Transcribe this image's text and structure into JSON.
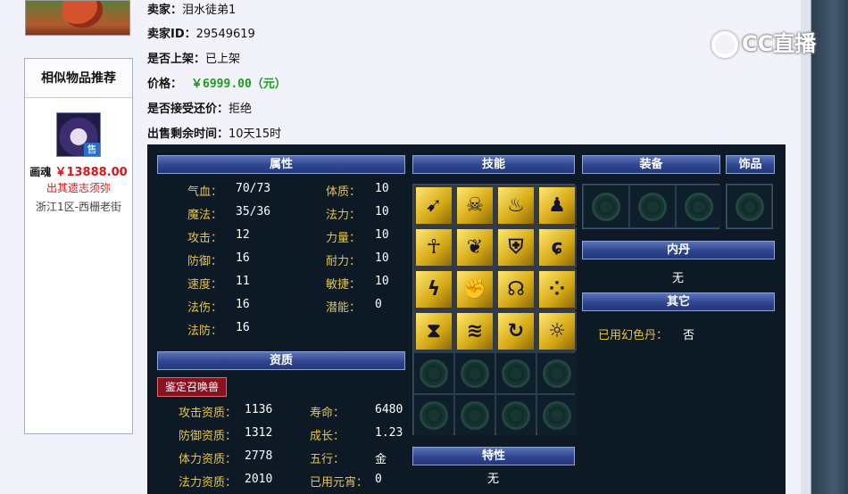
{
  "seller": {
    "name_label": "卖家：",
    "name": "泪水徒弟1",
    "id_label": "卖家ID：",
    "id": "29549619",
    "listed_label": "是否上架：",
    "listed": "已上架",
    "price_label": "价格：",
    "price": "￥6999.00（元）",
    "counter_label": "是否接受还价：",
    "counter": "拒绝",
    "time_label": "出售剩余时间：",
    "time": "10天15时"
  },
  "recommend": {
    "title": "相似物品推荐",
    "item_name": "画魂",
    "item_price": "￥13888.00",
    "item_note": "出其遗志须弥",
    "item_server": "浙江1区-西栅老街",
    "sold_badge": "售"
  },
  "watermark": {
    "text": "CC直播"
  },
  "panel": {
    "attr_title": "属性",
    "skill_title": "技能",
    "equip_title": "装备",
    "acc_title": "饰品",
    "neidan_title": "内丹",
    "neidan_value": "无",
    "other_title": "其它",
    "other_label": "已用幻色丹：",
    "other_value": "否",
    "quality_title": "资质",
    "appraise_button": "鉴定召唤兽",
    "trait_title": "特性",
    "trait_value": "无",
    "attrs": [
      {
        "l1": "气血：",
        "v1": "70/73",
        "l2": "体质：",
        "v2": "10"
      },
      {
        "l1": "魔法：",
        "v1": "35/36",
        "l2": "法力：",
        "v2": "10"
      },
      {
        "l1": "攻击：",
        "v1": "12",
        "l2": "力量：",
        "v2": "10"
      },
      {
        "l1": "防御：",
        "v1": "16",
        "l2": "耐力：",
        "v2": "10"
      },
      {
        "l1": "速度：",
        "v1": "11",
        "l2": "敏捷：",
        "v2": "10"
      },
      {
        "l1": "法伤：",
        "v1": "16",
        "l2": "潜能：",
        "v2": "0"
      },
      {
        "l1": "法防：",
        "v1": "16",
        "l2": "",
        "v2": ""
      }
    ],
    "quality": [
      {
        "l1": "攻击资质：",
        "v1": "1136",
        "l2": "寿命：",
        "v2": "6480"
      },
      {
        "l1": "防御资质：",
        "v1": "1312",
        "l2": "成长：",
        "v2": "1.23"
      },
      {
        "l1": "体力资质：",
        "v1": "2778",
        "l2": "五行：",
        "v2": "金"
      },
      {
        "l1": "法力资质：",
        "v1": "2010",
        "l2": "已用元宵：",
        "v2": "0"
      }
    ],
    "skills": [
      {
        "icon": "bow-skill-icon",
        "glyph": "➹"
      },
      {
        "icon": "skeleton-skill-icon",
        "glyph": "☠"
      },
      {
        "icon": "flame-skill-icon",
        "glyph": "♨"
      },
      {
        "icon": "figure-skill-icon",
        "glyph": "♟"
      },
      {
        "icon": "doll-skill-icon",
        "glyph": "☥"
      },
      {
        "icon": "wings-skill-icon",
        "glyph": "❦"
      },
      {
        "icon": "shield-skill-icon",
        "glyph": "⛨"
      },
      {
        "icon": "swirl-skill-icon",
        "glyph": "ɕ"
      },
      {
        "icon": "lightning-skill-icon",
        "glyph": "ϟ"
      },
      {
        "icon": "fist-skill-icon",
        "glyph": "✊"
      },
      {
        "icon": "head-skill-icon",
        "glyph": "☊"
      },
      {
        "icon": "dots-skill-icon",
        "glyph": "⁘"
      },
      {
        "icon": "hourglass-skill-icon",
        "glyph": "⧗"
      },
      {
        "icon": "wave-skill-icon",
        "glyph": "≋"
      },
      {
        "icon": "hook-skill-icon",
        "glyph": "↻"
      },
      {
        "icon": "sun-skill-icon",
        "glyph": "☼"
      },
      {
        "icon": "empty-slot-icon",
        "glyph": ""
      },
      {
        "icon": "empty-slot-icon",
        "glyph": ""
      },
      {
        "icon": "empty-slot-icon",
        "glyph": ""
      },
      {
        "icon": "empty-slot-icon",
        "glyph": ""
      },
      {
        "icon": "empty-slot-icon",
        "glyph": ""
      },
      {
        "icon": "empty-slot-icon",
        "glyph": ""
      },
      {
        "icon": "empty-slot-icon",
        "glyph": ""
      },
      {
        "icon": "empty-slot-icon",
        "glyph": ""
      }
    ]
  }
}
